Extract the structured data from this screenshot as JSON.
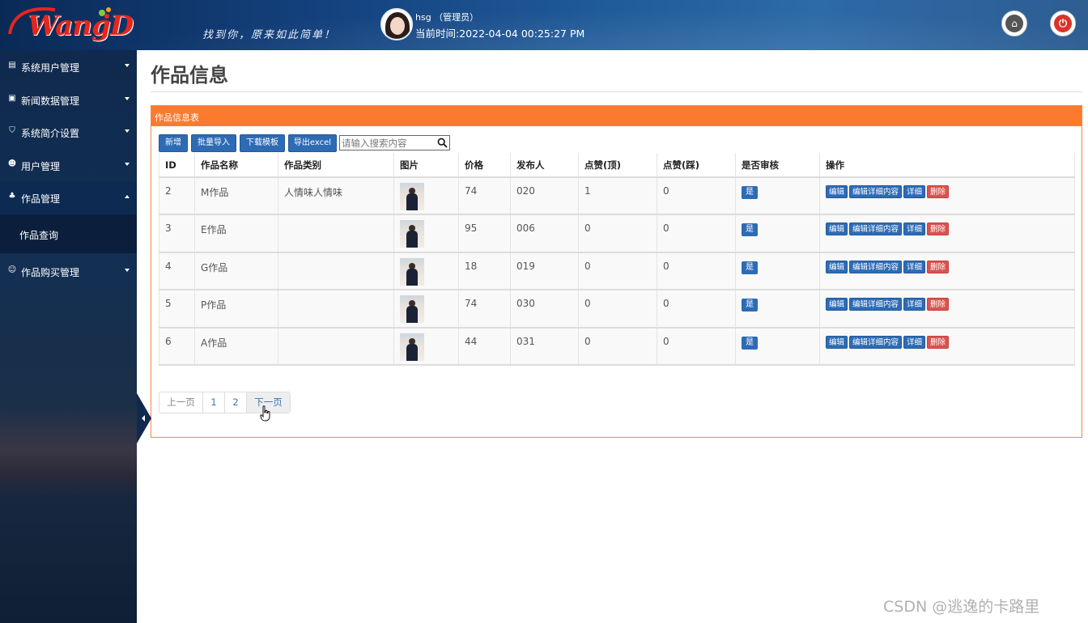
{
  "header": {
    "logo_text": "WangD",
    "slogan": "找到你，原来如此简单！",
    "user_name": "hsg （管理员）",
    "current_time": "当前时间:2022-04-04 00:25:27 PM"
  },
  "sidebar": {
    "items": [
      {
        "label": "系统用户管理",
        "icon": "id-card-icon"
      },
      {
        "label": "新闻数据管理",
        "icon": "news-icon"
      },
      {
        "label": "系统简介设置",
        "icon": "shield-icon"
      },
      {
        "label": "用户管理",
        "icon": "users-icon"
      },
      {
        "label": "作品管理",
        "icon": "sitemap-icon"
      },
      {
        "label": "作品购买管理",
        "icon": "user-plus-icon"
      }
    ],
    "submenu_label": "作品查询"
  },
  "main": {
    "title": "作品信息",
    "panel_title": "作品信息表",
    "toolbar": {
      "add": "新增",
      "batch_import": "批量导入",
      "download_template": "下载模板",
      "export_excel": "导出excel",
      "search_placeholder": "请输入搜索内容"
    },
    "table": {
      "columns": [
        "ID",
        "作品名称",
        "作品类别",
        "图片",
        "价格",
        "发布人",
        "点赞(顶)",
        "点赞(踩)",
        "是否审核",
        "操作"
      ],
      "rows": [
        {
          "id": "2",
          "name": "M作品",
          "category": "人情味人情味",
          "price": "74",
          "publisher": "020",
          "likes": "1",
          "dislikes": "0",
          "approved": "是"
        },
        {
          "id": "3",
          "name": "E作品",
          "category": "",
          "price": "95",
          "publisher": "006",
          "likes": "0",
          "dislikes": "0",
          "approved": "是"
        },
        {
          "id": "4",
          "name": "G作品",
          "category": "",
          "price": "18",
          "publisher": "019",
          "likes": "0",
          "dislikes": "0",
          "approved": "是"
        },
        {
          "id": "5",
          "name": "P作品",
          "category": "",
          "price": "74",
          "publisher": "030",
          "likes": "0",
          "dislikes": "0",
          "approved": "是"
        },
        {
          "id": "6",
          "name": "A作品",
          "category": "",
          "price": "44",
          "publisher": "031",
          "likes": "0",
          "dislikes": "0",
          "approved": "是"
        }
      ],
      "actions": {
        "edit": "编辑",
        "edit_detail": "编辑详细内容",
        "detail": "详细",
        "delete": "删除"
      }
    },
    "pagination": {
      "prev": "上一页",
      "pages": [
        "1",
        "2"
      ],
      "next": "下一页"
    }
  },
  "watermark": "CSDN @逃逸的卡路里",
  "colors": {
    "accent": "#fc7a2e",
    "primary_button": "#2d6bb5",
    "danger_button": "#d9534f",
    "sidebar": "#132f52"
  }
}
